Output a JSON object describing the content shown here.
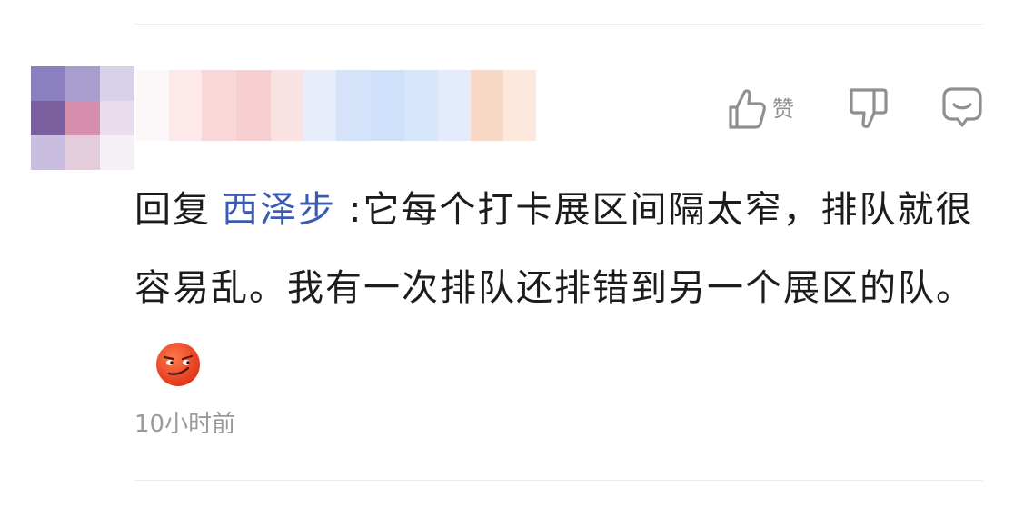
{
  "comment": {
    "actions": {
      "like_label": "赞",
      "like_icon": "thumbs-up-icon",
      "dislike_icon": "thumbs-down-icon",
      "reply_icon": "comment-bubble-icon",
      "icon_color": "#8f8f8f"
    },
    "reply_prefix": "回复",
    "mention_user": "西泽步",
    "mention_color": "#3a5bb3",
    "text": ":它每个打卡展区间隔太窄，排队就很容易乱。我有一次排队还排错到另一个展区的队。",
    "emoji": "smirk-face-emoji",
    "timestamp": "10小时前"
  }
}
